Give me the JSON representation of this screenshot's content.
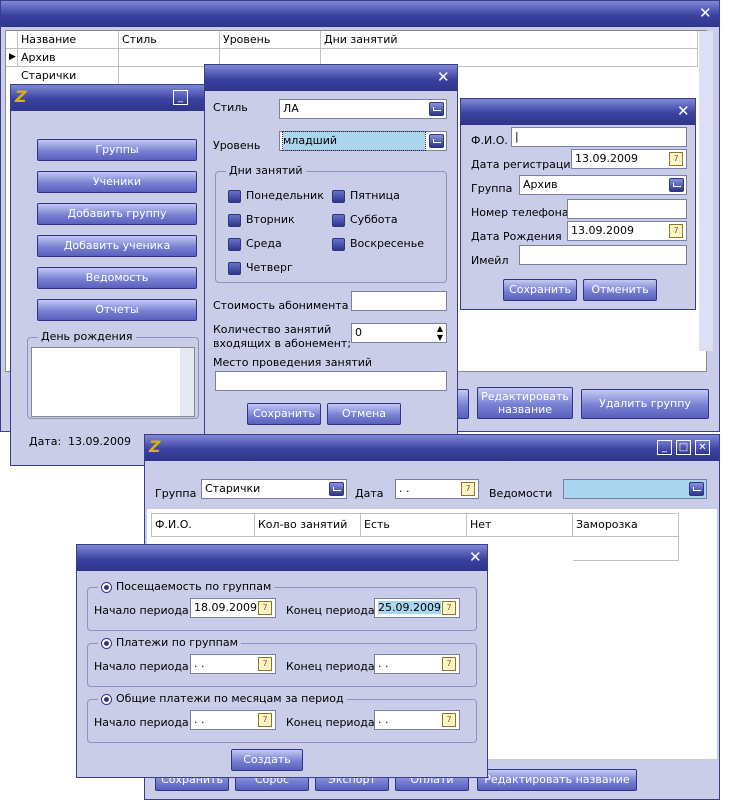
{
  "groups_window": {
    "columns": [
      "Название",
      "Стиль",
      "Уровень",
      "Дни занятий"
    ],
    "rows": [
      "Архив",
      "Старички"
    ],
    "buttons": {
      "edit_name": "Редактировать название",
      "delete_group": "Удалить группу"
    }
  },
  "main_menu": {
    "buttons": [
      "Группы",
      "Ученики",
      "Добавить группу",
      "Добавить ученика",
      "Ведомость",
      "Отчеты"
    ],
    "birthday_label": "День рождения",
    "date_label": "Дата:",
    "date_value": "13.09.2009"
  },
  "group_dialog": {
    "style_label": "Стиль",
    "style_value": "ЛА",
    "level_label": "Уровень",
    "level_value": "младший",
    "days_label": "Дни занятий",
    "days": [
      "Понедельник",
      "Пятница",
      "Вторник",
      "Суббота",
      "Среда",
      "Воскресенье",
      "Четверг"
    ],
    "price_label": "Стоимость абонимента",
    "price_value": "",
    "count_label_1": "Количество занятий",
    "count_label_2": "входящих в абонемент;",
    "count_value": "0",
    "place_label": "Место проведения занятий",
    "save": "Сохранить",
    "cancel": "Отмена"
  },
  "student_dialog": {
    "fio_label": "Ф.И.О.",
    "reg_date_label": "Дата регистрации",
    "reg_date_value": "13.09.2009",
    "group_label": "Группа",
    "group_value": "Архив",
    "phone_label": "Номер телефона",
    "birth_label": "Дата Рождения",
    "birth_value": "13.09.2009",
    "email_label": "Имейл",
    "save": "Сохранить",
    "cancel": "Отменить"
  },
  "attendance_window": {
    "group_label": "Группа",
    "group_value": "Старички",
    "date_label": "Дата",
    "date_value": " .  .",
    "sheet_label": "Ведомости",
    "columns": [
      "Ф.И.О.",
      "Кол-во занятий",
      "Есть",
      "Нет",
      "Заморозка"
    ],
    "bottom_buttons": [
      "Сохранить",
      "Сброс",
      "Экспорт",
      "Оплати",
      "Редактировать название"
    ]
  },
  "reports_dialog": {
    "sections": [
      {
        "title": "Посещаемость по группам",
        "start_label": "Начало периода",
        "start": "18.09.2009",
        "end_label": "Конец периода",
        "end": "25.09.2009"
      },
      {
        "title": "Платежи по группам",
        "start_label": "Начало периода",
        "start": " .  .",
        "end_label": "Конец периода",
        "end": " .  ."
      },
      {
        "title": "Общие платежи по месяцам за период",
        "start_label": "Начало периода",
        "start": " .  .",
        "end_label": "Конец периода",
        "end": " .  ."
      }
    ],
    "create": "Создать"
  },
  "colors": {
    "title_bar": "#3a42a0",
    "window_bg": "#c9cde8",
    "button": "#6a72cc"
  }
}
